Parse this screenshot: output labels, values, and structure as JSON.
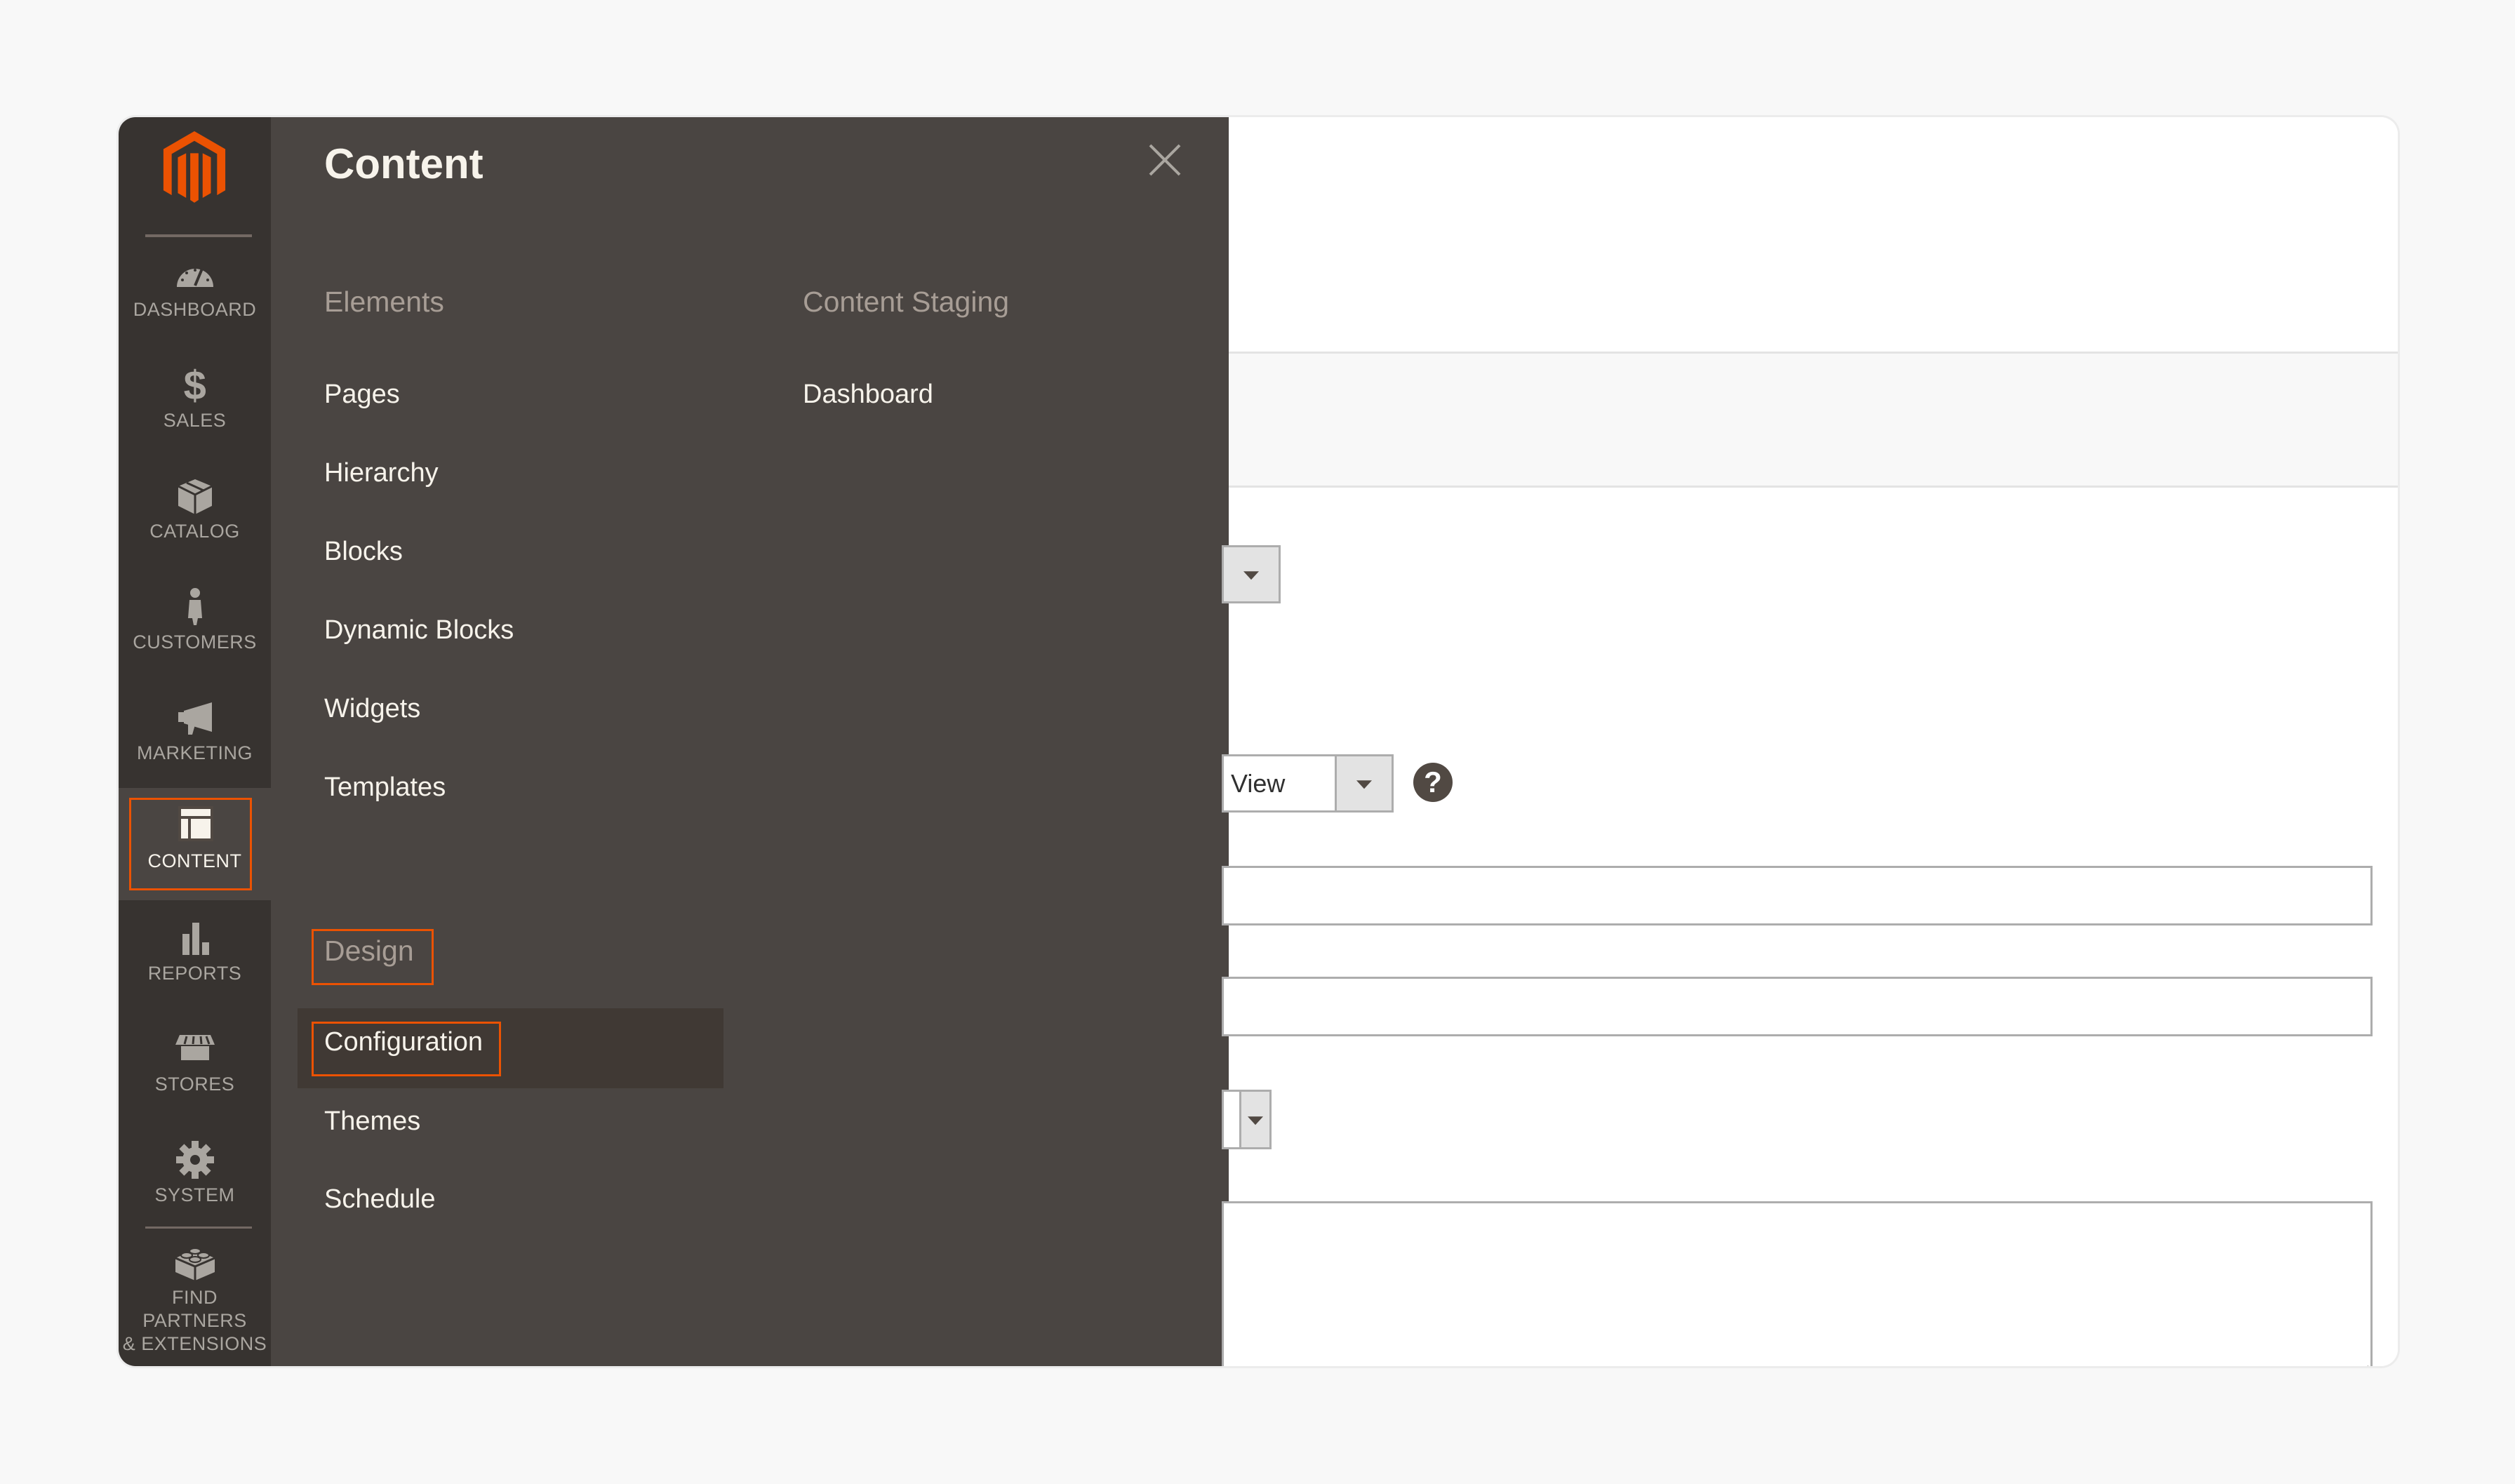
{
  "app": {
    "name": "Magento Admin",
    "accent_color": "#eb5202",
    "nav_bg": "#373330",
    "flyout_bg": "#4a4542"
  },
  "sidebar": {
    "logo": "magento-logo",
    "items": [
      {
        "label": "DASHBOARD",
        "icon": "dashboard-gauge-icon"
      },
      {
        "label": "SALES",
        "icon": "dollar-icon"
      },
      {
        "label": "CATALOG",
        "icon": "box-icon"
      },
      {
        "label": "CUSTOMERS",
        "icon": "person-icon"
      },
      {
        "label": "MARKETING",
        "icon": "megaphone-icon"
      },
      {
        "label": "CONTENT",
        "icon": "layout-icon",
        "active": true
      },
      {
        "label": "REPORTS",
        "icon": "bar-chart-icon"
      },
      {
        "label": "STORES",
        "icon": "storefront-icon"
      },
      {
        "label": "SYSTEM",
        "icon": "gear-icon"
      },
      {
        "label_line1": "FIND PARTNERS",
        "label_line2": "& EXTENSIONS",
        "icon": "lego-brick-icon"
      }
    ]
  },
  "flyout": {
    "title": "Content",
    "close_icon": "close-icon",
    "groups": [
      {
        "title": "Elements",
        "links": [
          "Pages",
          "Hierarchy",
          "Blocks",
          "Dynamic Blocks",
          "Widgets",
          "Templates"
        ]
      },
      {
        "title": "Content Staging",
        "links": [
          "Dashboard"
        ]
      },
      {
        "title": "Design",
        "highlighted": true,
        "links": [
          "Configuration",
          "Themes",
          "Schedule"
        ],
        "active_link": "Configuration"
      }
    ]
  },
  "form": {
    "select_1_value": "",
    "select_2_value": "View",
    "help_icon": "?",
    "input_1_value": "",
    "input_2_value": "",
    "select_3_value": "",
    "textarea_value": ""
  }
}
